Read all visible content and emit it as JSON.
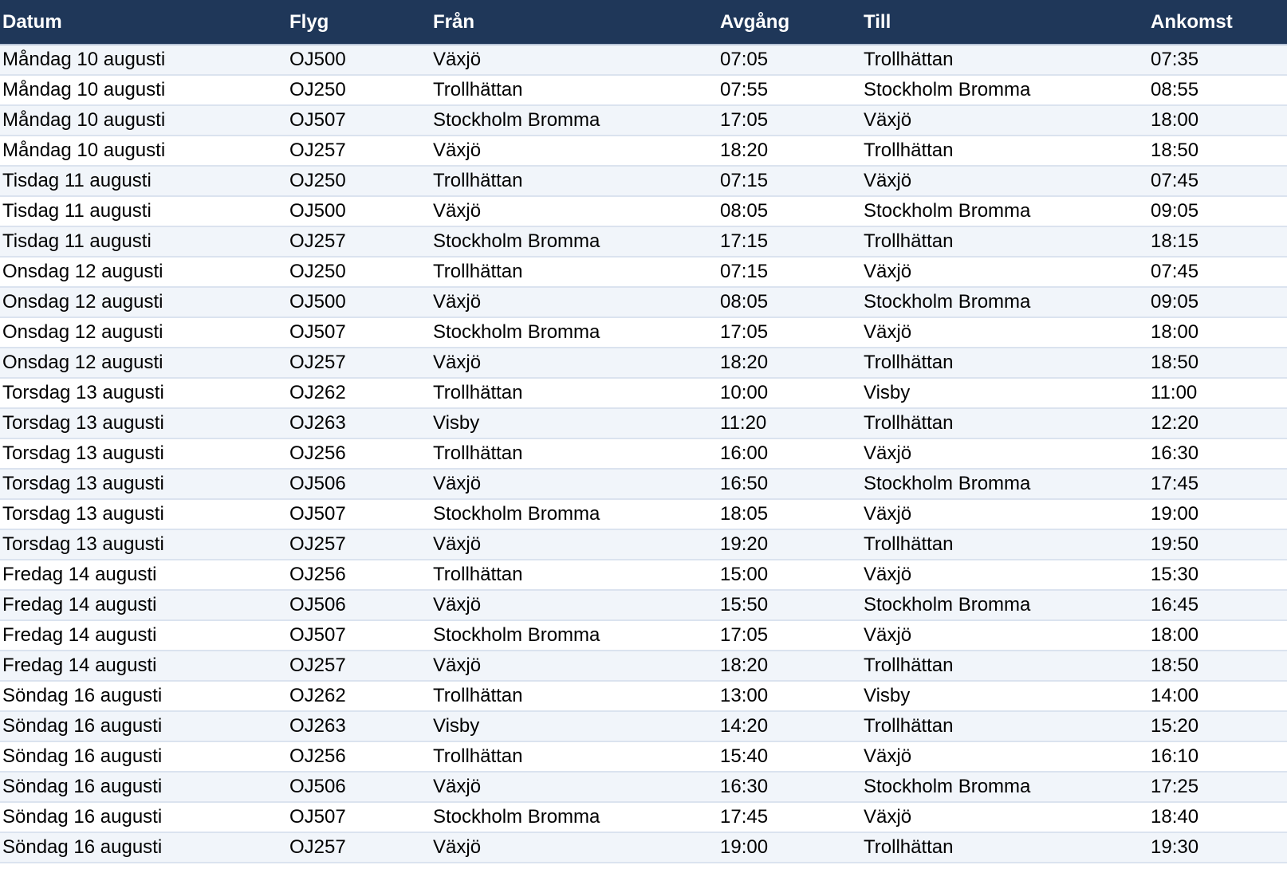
{
  "columns": [
    "Datum",
    "Flyg",
    "Från",
    "Avgång",
    "Till",
    "Ankomst"
  ],
  "rows": [
    [
      "Måndag 10 augusti",
      "OJ500",
      "Växjö",
      "07:05",
      "Trollhättan",
      "07:35"
    ],
    [
      "Måndag 10 augusti",
      "OJ250",
      "Trollhättan",
      "07:55",
      "Stockholm Bromma",
      "08:55"
    ],
    [
      "Måndag 10 augusti",
      "OJ507",
      "Stockholm Bromma",
      "17:05",
      "Växjö",
      "18:00"
    ],
    [
      "Måndag 10 augusti",
      "OJ257",
      "Växjö",
      "18:20",
      "Trollhättan",
      "18:50"
    ],
    [
      "Tisdag 11 augusti",
      "OJ250",
      "Trollhättan",
      "07:15",
      "Växjö",
      "07:45"
    ],
    [
      "Tisdag 11 augusti",
      "OJ500",
      "Växjö",
      "08:05",
      "Stockholm Bromma",
      "09:05"
    ],
    [
      "Tisdag 11 augusti",
      "OJ257",
      "Stockholm Bromma",
      "17:15",
      "Trollhättan",
      "18:15"
    ],
    [
      "Onsdag 12 augusti",
      "OJ250",
      "Trollhättan",
      "07:15",
      "Växjö",
      "07:45"
    ],
    [
      "Onsdag 12 augusti",
      "OJ500",
      "Växjö",
      "08:05",
      "Stockholm Bromma",
      "09:05"
    ],
    [
      "Onsdag 12 augusti",
      "OJ507",
      "Stockholm Bromma",
      "17:05",
      "Växjö",
      "18:00"
    ],
    [
      "Onsdag 12 augusti",
      "OJ257",
      "Växjö",
      "18:20",
      "Trollhättan",
      "18:50"
    ],
    [
      "Torsdag 13 augusti",
      "OJ262",
      "Trollhättan",
      "10:00",
      "Visby",
      "11:00"
    ],
    [
      "Torsdag 13 augusti",
      "OJ263",
      "Visby",
      "11:20",
      "Trollhättan",
      "12:20"
    ],
    [
      "Torsdag 13 augusti",
      "OJ256",
      "Trollhättan",
      "16:00",
      "Växjö",
      "16:30"
    ],
    [
      "Torsdag 13 augusti",
      "OJ506",
      "Växjö",
      "16:50",
      "Stockholm Bromma",
      "17:45"
    ],
    [
      "Torsdag 13 augusti",
      "OJ507",
      "Stockholm Bromma",
      "18:05",
      "Växjö",
      "19:00"
    ],
    [
      "Torsdag 13 augusti",
      "OJ257",
      "Växjö",
      "19:20",
      "Trollhättan",
      "19:50"
    ],
    [
      "Fredag 14 augusti",
      "OJ256",
      "Trollhättan",
      "15:00",
      "Växjö",
      "15:30"
    ],
    [
      "Fredag 14 augusti",
      "OJ506",
      "Växjö",
      "15:50",
      "Stockholm Bromma",
      "16:45"
    ],
    [
      "Fredag 14 augusti",
      "OJ507",
      "Stockholm Bromma",
      "17:05",
      "Växjö",
      "18:00"
    ],
    [
      "Fredag 14 augusti",
      "OJ257",
      "Växjö",
      "18:20",
      "Trollhättan",
      "18:50"
    ],
    [
      "Söndag 16 augusti",
      "OJ262",
      "Trollhättan",
      "13:00",
      "Visby",
      "14:00"
    ],
    [
      "Söndag 16 augusti",
      "OJ263",
      "Visby",
      "14:20",
      "Trollhättan",
      "15:20"
    ],
    [
      "Söndag 16 augusti",
      "OJ256",
      "Trollhättan",
      "15:40",
      "Växjö",
      "16:10"
    ],
    [
      "Söndag 16 augusti",
      "OJ506",
      "Växjö",
      "16:30",
      "Stockholm Bromma",
      "17:25"
    ],
    [
      "Söndag 16 augusti",
      "OJ507",
      "Stockholm Bromma",
      "17:45",
      "Växjö",
      "18:40"
    ],
    [
      "Söndag 16 augusti",
      "OJ257",
      "Växjö",
      "19:00",
      "Trollhättan",
      "19:30"
    ]
  ],
  "colors": {
    "header_background": "#1f3759",
    "header_text": "#ffffff",
    "band_row": "#f1f5fa",
    "row_divider": "#dbe3ef"
  }
}
